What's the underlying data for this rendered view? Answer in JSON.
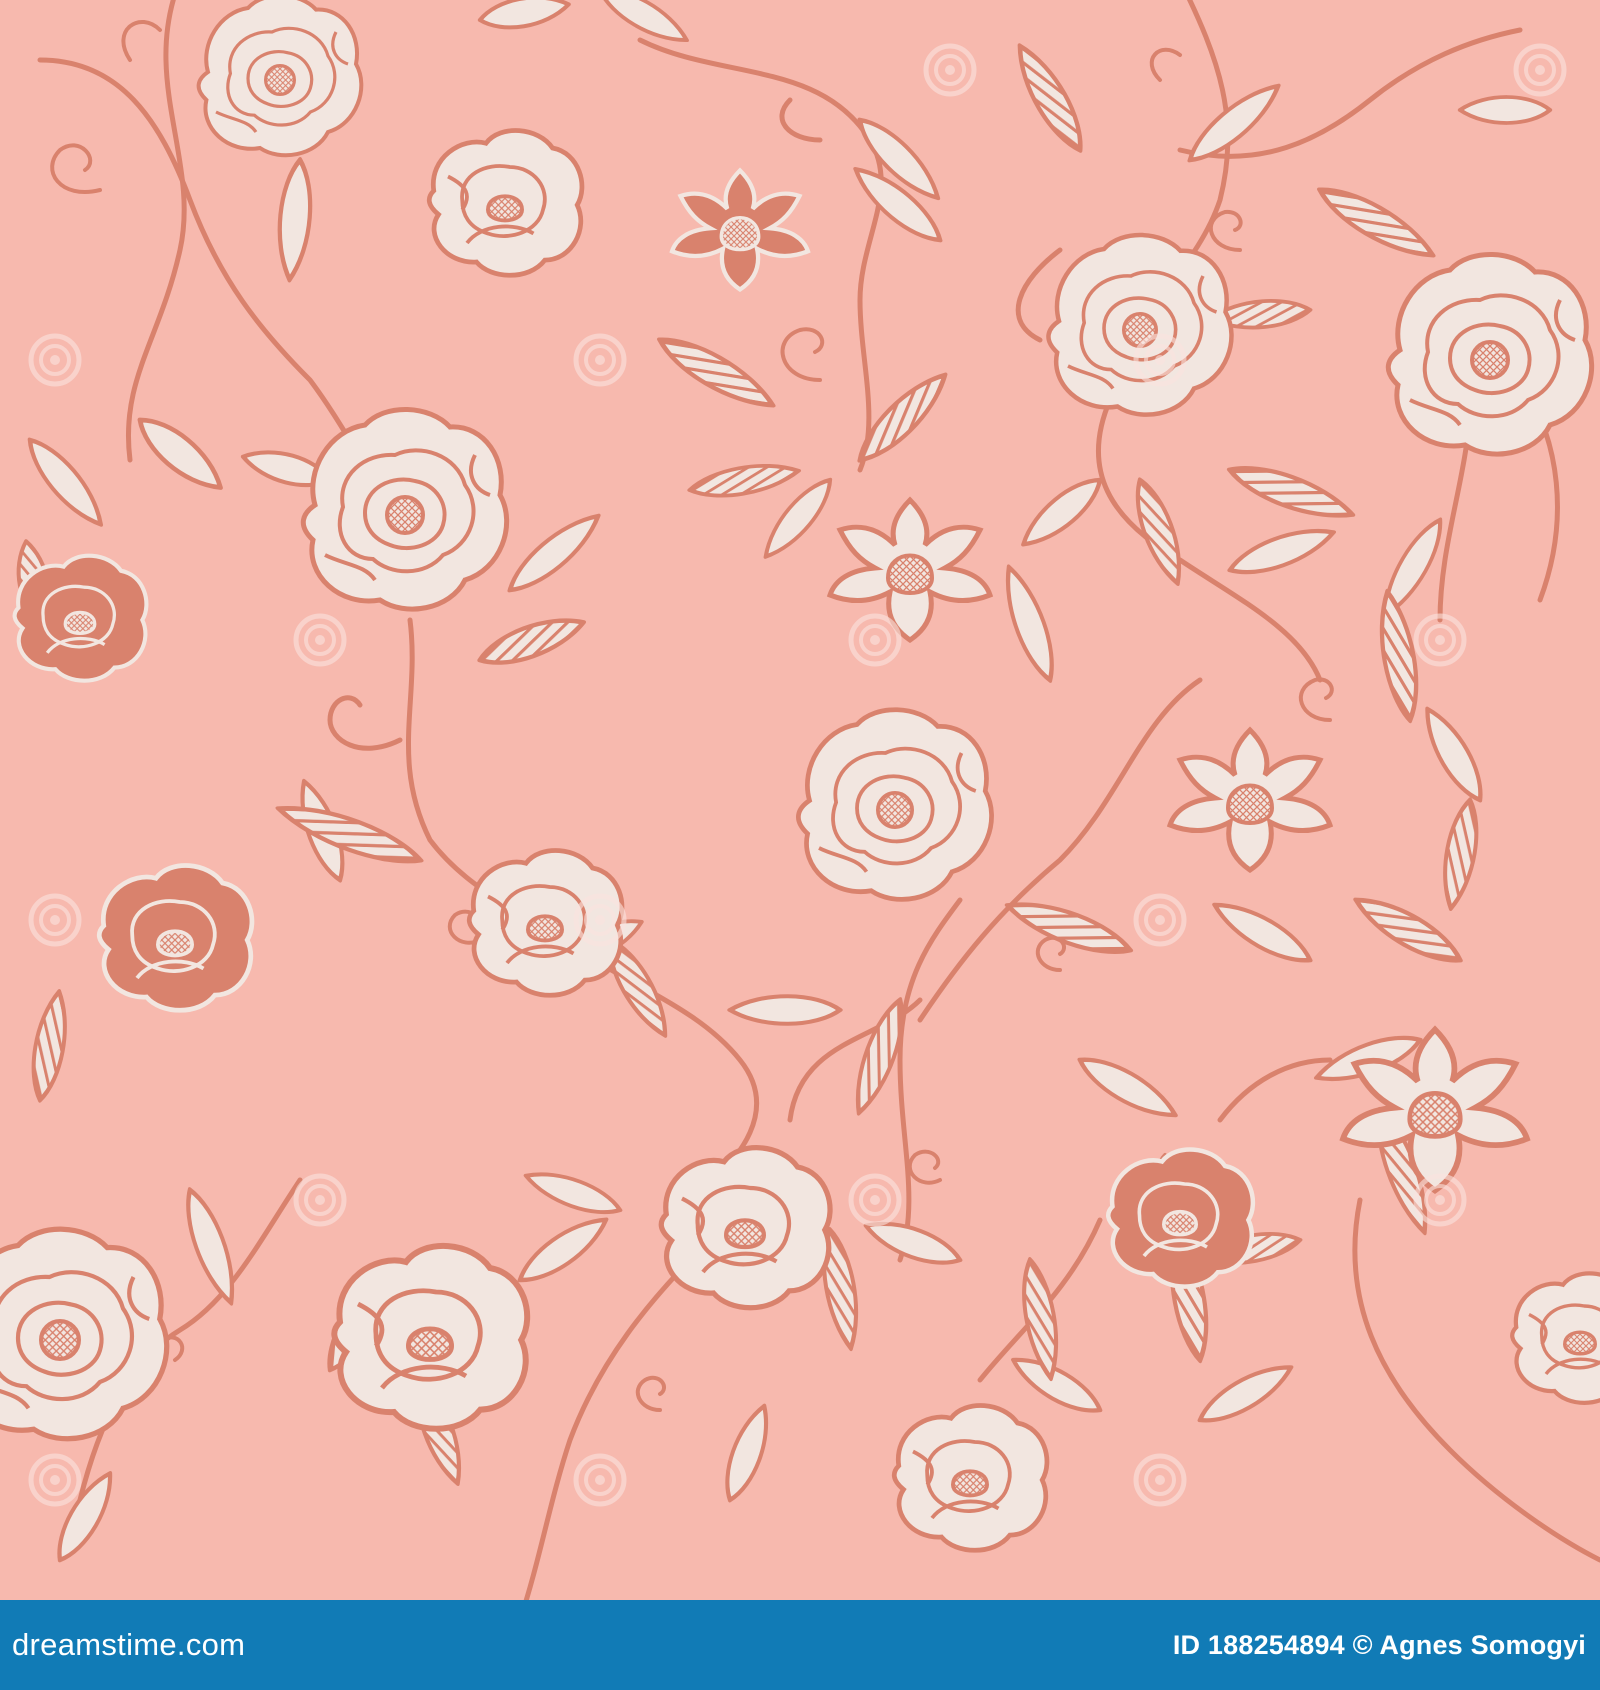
{
  "colors": {
    "background": "#f7b9ae",
    "stem": "#d9826d",
    "petal": "#f2e6e0",
    "flower_dark": "#d9826d",
    "footer": "#117bb6",
    "footer_text": "#ffffff"
  },
  "footer": {
    "site": "dreamstime.com",
    "id_text": "ID 188254894 © Agnes Somogyi"
  },
  "icons": {
    "watermark": "dreamstime-swirl-logo-icon"
  }
}
